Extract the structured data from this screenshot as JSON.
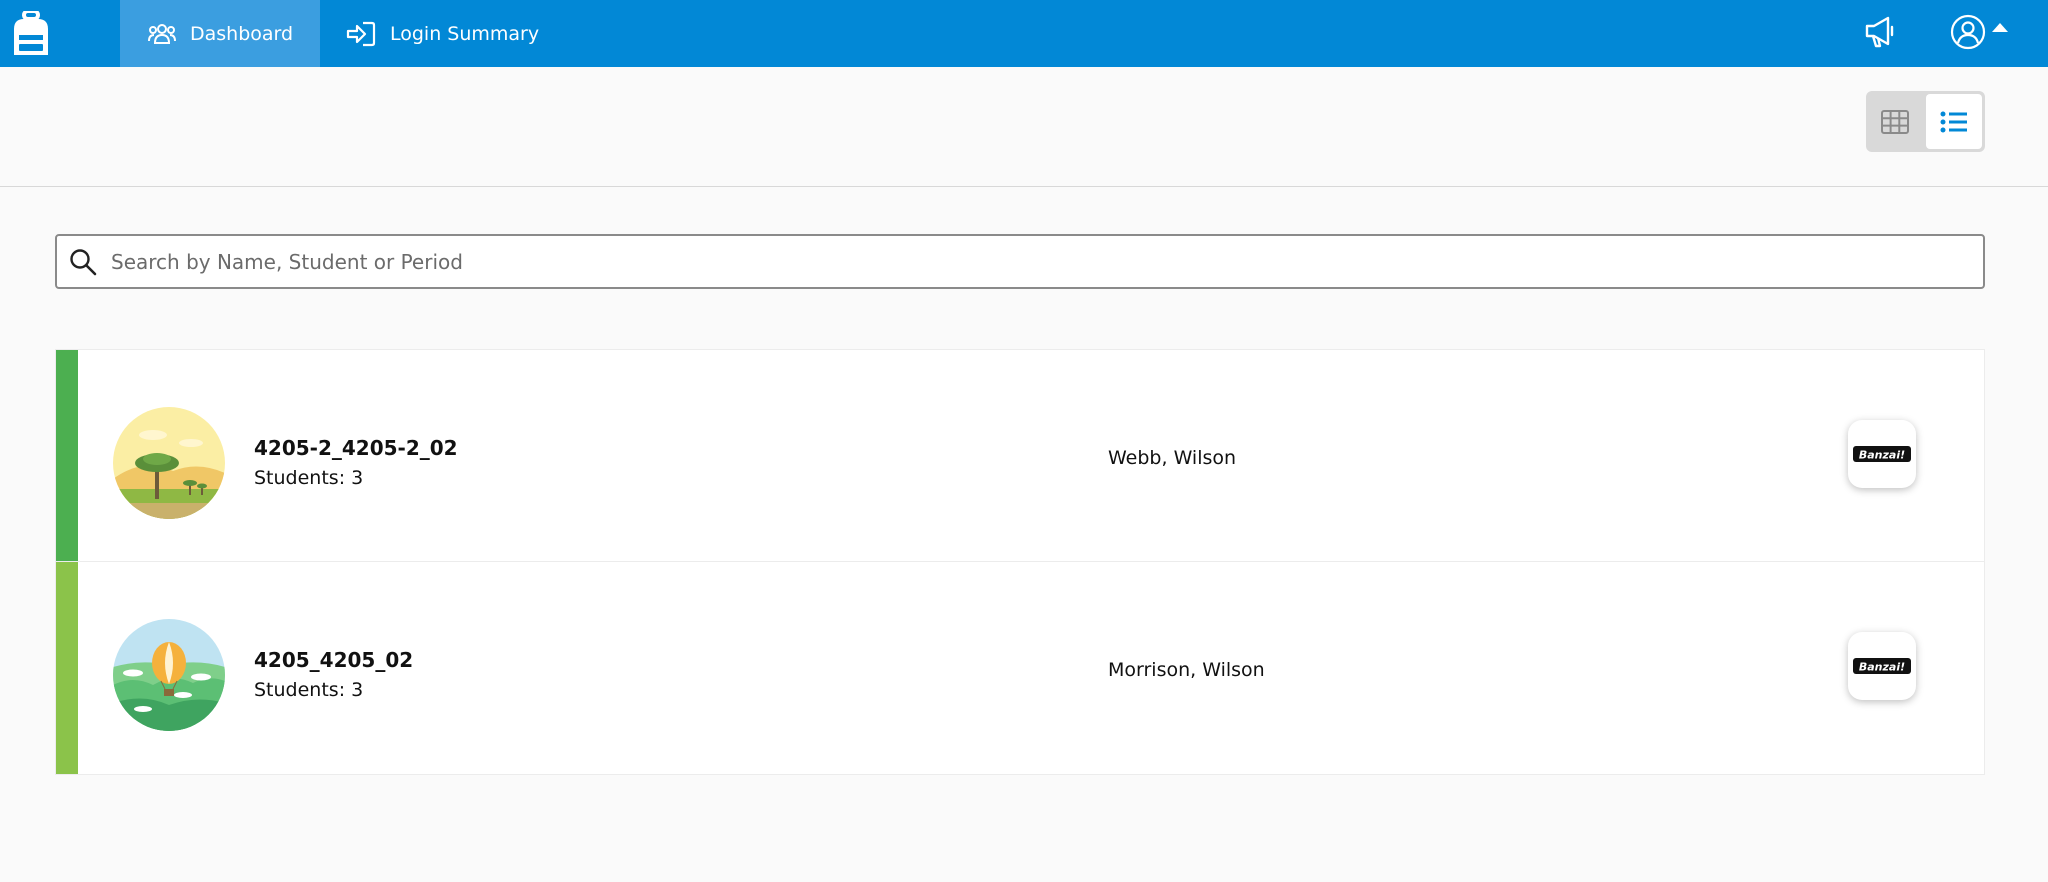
{
  "nav": {
    "tabs": [
      {
        "label": "Dashboard",
        "icon": "users-icon",
        "active": true
      },
      {
        "label": "Login Summary",
        "icon": "sign-in-icon",
        "active": false
      }
    ]
  },
  "view": {
    "selected": "list"
  },
  "search": {
    "placeholder": "Search by Name, Student or Period",
    "value": ""
  },
  "classes": [
    {
      "name": "4205-2_4205-2_02",
      "students": "Students: 3",
      "teacher": "Webb, Wilson",
      "stripe_color": "#4caf50",
      "avatar": "savanna-image",
      "app": "Banzai!"
    },
    {
      "name": "4205_4205_02",
      "students": "Students: 3",
      "teacher": "Morrison, Wilson",
      "stripe_color": "#8bc34a",
      "avatar": "hot-air-balloon-image",
      "app": "Banzai!"
    }
  ],
  "colors": {
    "brand": "#0288d6",
    "active_tab": "#3b9ee0",
    "list_icon": "#0288d6"
  }
}
